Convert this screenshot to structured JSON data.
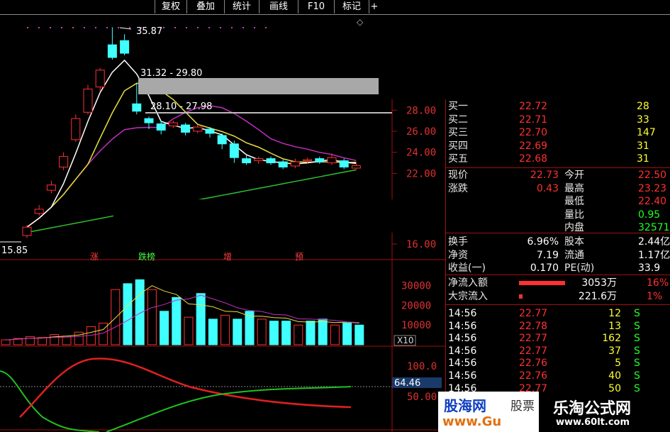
{
  "toolbar": {
    "items": [
      "复权",
      "叠加",
      "统计",
      "画线",
      "F10",
      "标记"
    ]
  },
  "price_labels": {
    "high": "35.87",
    "zone1": "31.32 - 29.80",
    "zone2": "28.10 - 27.98",
    "low": "15.85"
  },
  "price_axis": [
    "28.00",
    "26.00",
    "24.00",
    "22.00",
    "16.00"
  ],
  "volume_axis": [
    "30000",
    "20000",
    "10000"
  ],
  "volume_unit": "X10",
  "indicator_axis": [
    "100.0",
    "50.00"
  ],
  "indicator_value": "64.46",
  "markers": [
    {
      "text": "涨",
      "color": "#ff4040"
    },
    {
      "text": "跌榜",
      "color": "#40ff40"
    },
    {
      "text": "增",
      "color": "#ff4040"
    },
    {
      "text": "预",
      "color": "#ff4040"
    }
  ],
  "orderbook": [
    {
      "label": "买一",
      "price": "22.72",
      "vol": "28"
    },
    {
      "label": "买二",
      "price": "22.71",
      "vol": "33"
    },
    {
      "label": "买三",
      "price": "22.70",
      "vol": "147"
    },
    {
      "label": "买四",
      "price": "22.69",
      "vol": "31"
    },
    {
      "label": "买五",
      "price": "22.68",
      "vol": "31"
    }
  ],
  "quote": [
    {
      "l1": "现价",
      "v1": "22.73",
      "l2": "今开",
      "v2": "22.50"
    },
    {
      "l1": "涨跌",
      "v1": "0.43",
      "l2": "最高",
      "v2": "23.23"
    },
    {
      "l1": "",
      "v1": "",
      "l2": "最低",
      "v2": "22.40"
    },
    {
      "l1": "",
      "v1": "",
      "l2": "量比",
      "v2": "0.95"
    },
    {
      "l1": "",
      "v1": "",
      "l2": "内盘",
      "v2": "32571"
    }
  ],
  "stats": [
    {
      "l1": "换手",
      "v1": "6.96%",
      "l2": "股本",
      "v2": "2.44亿"
    },
    {
      "l1": "净资",
      "v1": "7.19",
      "l2": "流通",
      "v2": "1.17亿"
    },
    {
      "l1": "收益(一)",
      "v1": "0.170",
      "l2": "PE(动)",
      "v2": "33.9"
    }
  ],
  "flows": [
    {
      "label": "净流入额",
      "value": "3053万",
      "pct": "16%",
      "bar": 0.65
    },
    {
      "label": "大宗流入",
      "value": "221.6万",
      "pct": "1%",
      "bar": 0.05
    }
  ],
  "ticks": [
    {
      "time": "14:56",
      "price": "22.77",
      "vol": "12",
      "side": "S"
    },
    {
      "time": "14:56",
      "price": "22.78",
      "vol": "13",
      "side": "S"
    },
    {
      "time": "14:56",
      "price": "22.77",
      "vol": "162",
      "side": "S"
    },
    {
      "time": "14:56",
      "price": "22.77",
      "vol": "37",
      "side": "S"
    },
    {
      "time": "14:56",
      "price": "22.76",
      "vol": "5",
      "side": "S"
    },
    {
      "time": "14:56",
      "price": "22.76",
      "vol": "40",
      "side": "S"
    },
    {
      "time": "14:56",
      "price": "22.77",
      "vol": "50",
      "side": "S"
    }
  ],
  "watermarks": {
    "left_main": "股海网",
    "left_side": "股票",
    "left_url": "www.Gu",
    "right_main": "乐淘公式网",
    "right_url": "www.60lt.com"
  },
  "colors": {
    "up": "#ff3030",
    "down": "#40ffff",
    "ma5": "#ffffff",
    "ma10": "#e8e040",
    "ma20": "#c030c0",
    "ma60": "#30c030"
  },
  "candles": [
    {
      "o": 16.1,
      "c": 16.9,
      "h": 17.1,
      "l": 15.85
    },
    {
      "o": 18.2,
      "c": 18.6,
      "h": 19.0,
      "l": 18.0
    },
    {
      "o": 20.4,
      "c": 20.9,
      "h": 21.3,
      "l": 20.1
    },
    {
      "o": 22.6,
      "c": 23.6,
      "h": 24.0,
      "l": 22.3
    },
    {
      "o": 25.2,
      "c": 27.2,
      "h": 27.6,
      "l": 25.0
    },
    {
      "o": 27.8,
      "c": 30.0,
      "h": 30.4,
      "l": 27.6
    },
    {
      "o": 30.2,
      "c": 31.8,
      "h": 32.0,
      "l": 29.8
    },
    {
      "o": 34.2,
      "c": 33.0,
      "h": 35.87,
      "l": 32.8
    },
    {
      "o": 34.6,
      "c": 33.4,
      "h": 35.2,
      "l": 33.2
    },
    {
      "o": 28.6,
      "c": 27.9,
      "h": 30.6,
      "l": 27.6
    },
    {
      "o": 27.2,
      "c": 26.8,
      "h": 27.4,
      "l": 26.2
    },
    {
      "o": 26.7,
      "c": 26.1,
      "h": 27.0,
      "l": 25.7
    },
    {
      "o": 26.5,
      "c": 26.8,
      "h": 27.0,
      "l": 26.3
    },
    {
      "o": 26.6,
      "c": 25.9,
      "h": 26.8,
      "l": 25.6
    },
    {
      "o": 26.0,
      "c": 26.4,
      "h": 26.6,
      "l": 25.8
    },
    {
      "o": 26.2,
      "c": 25.8,
      "h": 26.4,
      "l": 25.4
    },
    {
      "o": 25.6,
      "c": 24.8,
      "h": 25.8,
      "l": 24.3
    },
    {
      "o": 24.8,
      "c": 23.5,
      "h": 25.1,
      "l": 23.0
    },
    {
      "o": 23.4,
      "c": 23.0,
      "h": 23.7,
      "l": 22.8
    },
    {
      "o": 23.2,
      "c": 23.4,
      "h": 23.6,
      "l": 22.9
    },
    {
      "o": 23.4,
      "c": 23.0,
      "h": 23.6,
      "l": 22.8
    },
    {
      "o": 23.1,
      "c": 22.6,
      "h": 23.3,
      "l": 22.4
    },
    {
      "o": 22.7,
      "c": 23.1,
      "h": 23.4,
      "l": 22.5
    },
    {
      "o": 23.2,
      "c": 23.3,
      "h": 23.5,
      "l": 22.9
    },
    {
      "o": 23.4,
      "c": 23.1,
      "h": 23.6,
      "l": 22.9
    },
    {
      "o": 23.0,
      "c": 23.5,
      "h": 23.9,
      "l": 22.8
    },
    {
      "o": 23.2,
      "c": 22.6,
      "h": 23.4,
      "l": 22.4
    },
    {
      "o": 22.5,
      "c": 22.73,
      "h": 22.9,
      "l": 22.4
    }
  ],
  "volumes": [
    2500,
    3200,
    4100,
    3700,
    5200,
    4400,
    6400,
    9200,
    11000,
    28000,
    31000,
    33000,
    28000,
    17000,
    24000,
    14000,
    26000,
    13000,
    15000,
    13000,
    17000,
    13000,
    12000,
    12000,
    10000,
    12000,
    13000,
    10000,
    11000,
    10000
  ]
}
